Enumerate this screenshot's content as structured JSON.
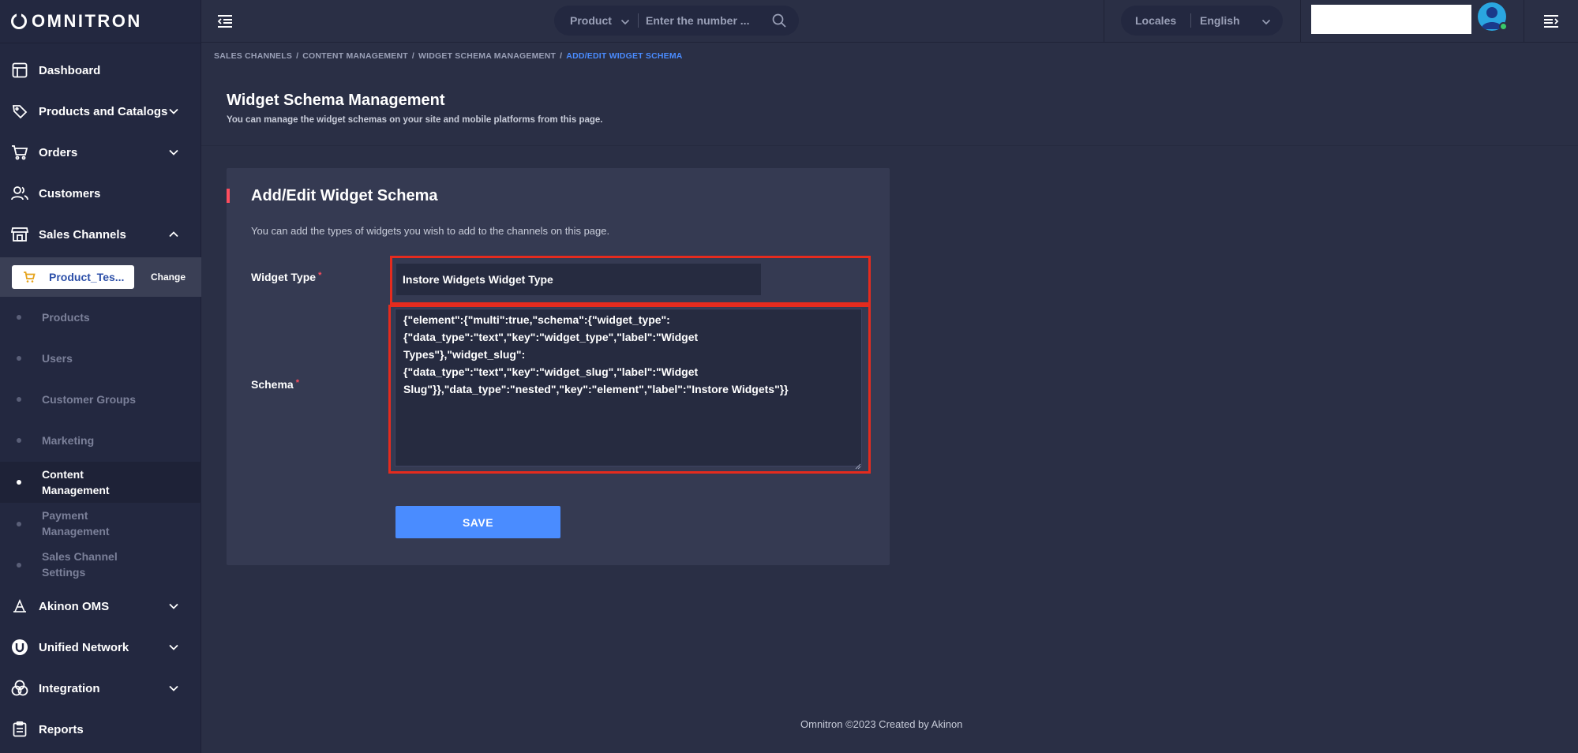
{
  "brand": {
    "name": "OMNITRON"
  },
  "sidebar": {
    "items": [
      {
        "label": "Dashboard",
        "icon": "dashboard-icon",
        "has_chevron": false
      },
      {
        "label": "Products and Catalogs",
        "icon": "tag-icon",
        "has_chevron": true
      },
      {
        "label": "Orders",
        "icon": "cart-icon",
        "has_chevron": true
      },
      {
        "label": "Customers",
        "icon": "users-icon",
        "has_chevron": false
      },
      {
        "label": "Sales Channels",
        "icon": "store-icon",
        "has_chevron": true,
        "expanded": true
      },
      {
        "label": "Akinon OMS",
        "icon": "oms-icon",
        "has_chevron": true
      },
      {
        "label": "Unified Network",
        "icon": "network-icon",
        "has_chevron": true
      },
      {
        "label": "Integration",
        "icon": "integration-icon",
        "has_chevron": true
      },
      {
        "label": "Reports",
        "icon": "report-icon",
        "has_chevron": false
      }
    ],
    "channel": {
      "label": "Product_Tes...",
      "change_label": "Change"
    },
    "sub_items": [
      {
        "label": "Products"
      },
      {
        "label": "Users"
      },
      {
        "label": "Customer Groups"
      },
      {
        "label": "Marketing"
      },
      {
        "label": "Content Management",
        "active": true
      },
      {
        "label": "Payment Management"
      },
      {
        "label": "Sales Channel Settings"
      }
    ]
  },
  "topbar": {
    "search": {
      "scope": "Product",
      "placeholder": "Enter the number ..."
    },
    "locale": {
      "label": "Locales",
      "value": "English"
    }
  },
  "breadcrumb": [
    "SALES CHANNELS",
    "CONTENT MANAGEMENT",
    "WIDGET SCHEMA MANAGEMENT",
    "ADD/EDIT WIDGET SCHEMA"
  ],
  "page": {
    "title": "Widget Schema Management",
    "subtitle": "You can manage the widget schemas on your site and mobile platforms from this page."
  },
  "form": {
    "title": "Add/Edit Widget Schema",
    "description": "You can add the types of widgets you wish to add to the channels on this page.",
    "widget_type_label": "Widget Type",
    "widget_type_value": "Instore Widgets Widget Type",
    "schema_label": "Schema",
    "schema_value": "{\"element\":{\"multi\":true,\"schema\":{\"widget_type\":\n{\"data_type\":\"text\",\"key\":\"widget_type\",\"label\":\"Widget\nTypes\"},\"widget_slug\":\n{\"data_type\":\"text\",\"key\":\"widget_slug\",\"label\":\"Widget\nSlug\"}},\"data_type\":\"nested\",\"key\":\"element\",\"label\":\"Instore Widgets\"}}",
    "required_mark": "*",
    "save_label": "SAVE"
  },
  "footer": {
    "text": "Omnitron ©2023 Created by Akinon"
  },
  "colors": {
    "accent": "#4a8cff",
    "required": "#ff4d5e",
    "highlight": "#e52b1e",
    "sidebar_bg": "#232840",
    "content_bg": "#2a2f45"
  }
}
